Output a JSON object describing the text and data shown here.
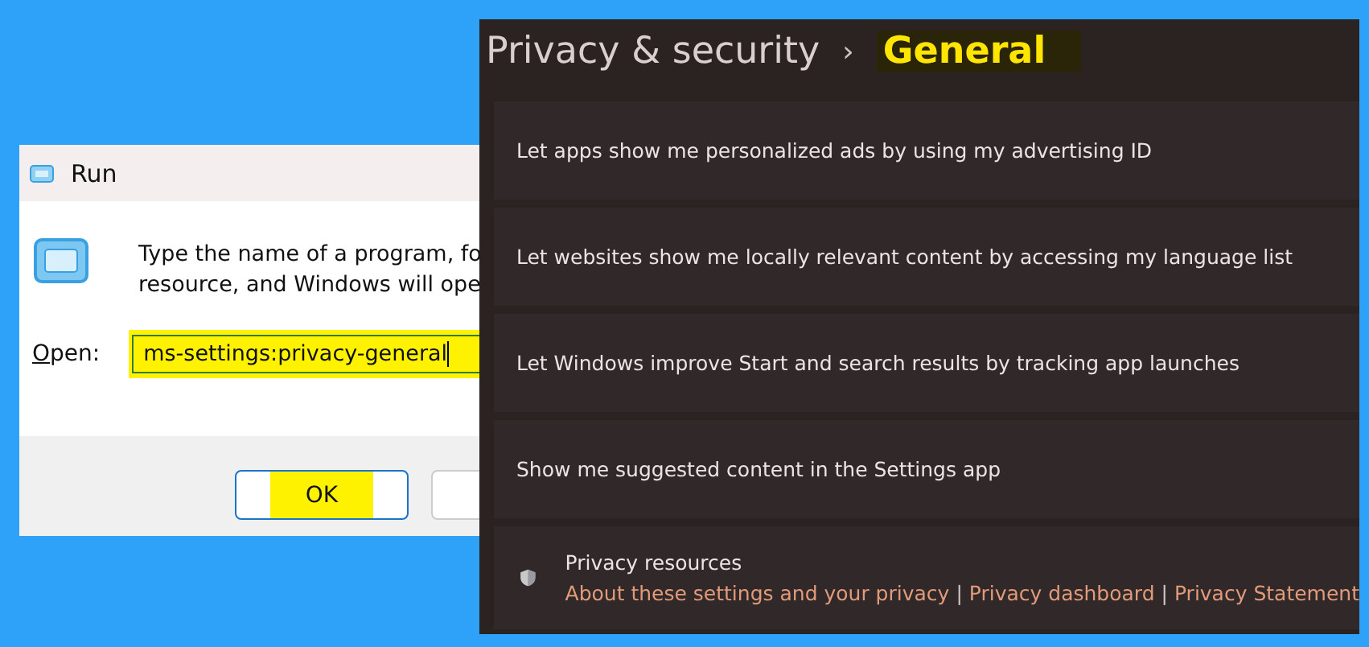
{
  "run_dialog": {
    "title": "Run",
    "description": [
      "Type the name of a program, fo",
      "resource, and Windows will ope"
    ],
    "open_label": "Open:",
    "open_field": {
      "value": "ms-settings:privacy-general",
      "highlighted": true
    },
    "buttons": [
      {
        "label": "OK",
        "highlighted": true
      }
    ],
    "second_button_visible": true
  },
  "settings": {
    "breadcrumb": [
      {
        "label": "Privacy & security",
        "highlighted": false
      },
      {
        "label": "General",
        "highlighted": true
      }
    ],
    "separator": "›",
    "rows": [
      {
        "label": "Let apps show me personalized ads by using my advertising ID"
      },
      {
        "label": "Let websites show me locally relevant content by accessing my language list"
      },
      {
        "label": "Let Windows improve Start and search results by tracking app launches"
      },
      {
        "label": "Show me suggested content in the Settings app"
      }
    ],
    "resources": {
      "title": "Privacy resources",
      "links": [
        "About these settings and your privacy",
        "Privacy dashboard",
        "Privacy Statement"
      ],
      "divider": "|"
    }
  }
}
